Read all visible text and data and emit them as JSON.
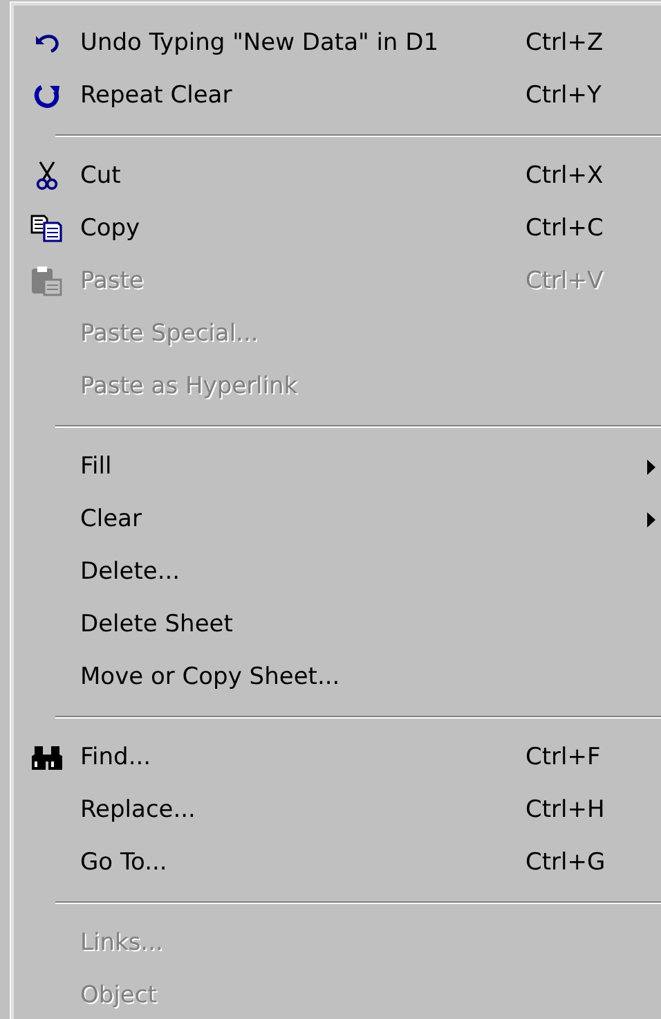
{
  "menu": {
    "groups": [
      {
        "items": [
          {
            "label": "Undo Typing \"New Data\" in D1",
            "shortcut": "Ctrl+Z",
            "kind": "undo",
            "disabled": false,
            "submenu": false
          },
          {
            "label": "Repeat Clear",
            "shortcut": "Ctrl+Y",
            "kind": "repeat",
            "disabled": false,
            "submenu": false
          }
        ]
      },
      {
        "items": [
          {
            "label": "Cut",
            "shortcut": "Ctrl+X",
            "kind": "cut",
            "disabled": false,
            "submenu": false
          },
          {
            "label": "Copy",
            "shortcut": "Ctrl+C",
            "kind": "copy",
            "disabled": false,
            "submenu": false
          },
          {
            "label": "Paste",
            "shortcut": "Ctrl+V",
            "kind": "paste",
            "disabled": true,
            "submenu": false
          },
          {
            "label": "Paste Special...",
            "disabled": true,
            "submenu": false
          },
          {
            "label": "Paste as Hyperlink",
            "disabled": true,
            "submenu": false
          }
        ]
      },
      {
        "items": [
          {
            "label": "Fill",
            "disabled": false,
            "submenu": true
          },
          {
            "label": "Clear",
            "disabled": false,
            "submenu": true
          },
          {
            "label": "Delete...",
            "disabled": false,
            "submenu": false
          },
          {
            "label": "Delete Sheet",
            "disabled": false,
            "submenu": false
          },
          {
            "label": "Move or Copy Sheet...",
            "disabled": false,
            "submenu": false
          }
        ]
      },
      {
        "items": [
          {
            "label": "Find...",
            "shortcut": "Ctrl+F",
            "kind": "find",
            "disabled": false,
            "submenu": false
          },
          {
            "label": "Replace...",
            "shortcut": "Ctrl+H",
            "disabled": false,
            "submenu": false
          },
          {
            "label": "Go To...",
            "shortcut": "Ctrl+G",
            "disabled": false,
            "submenu": false
          }
        ]
      },
      {
        "items": [
          {
            "label": "Links...",
            "disabled": true,
            "submenu": false
          },
          {
            "label": "Object",
            "disabled": true,
            "submenu": false
          }
        ]
      }
    ]
  }
}
